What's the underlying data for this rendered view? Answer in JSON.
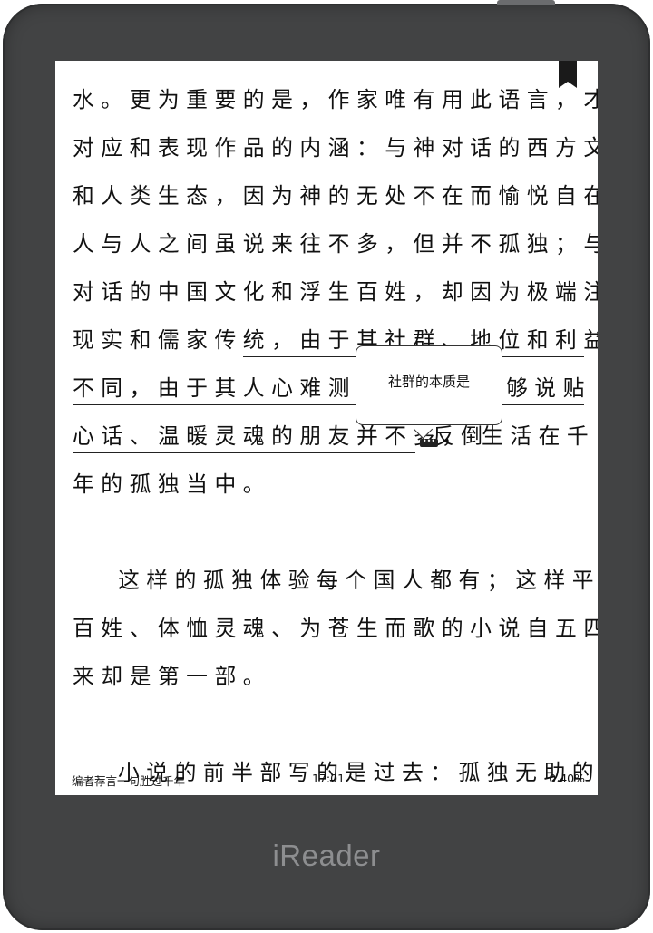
{
  "device": {
    "brand": "iReader"
  },
  "reader": {
    "lines": [
      "水。更为重要的是，作家唯有用此语言，才有",
      "对应和表现作品的内涵：与神对话的西方文化",
      "和人类生态，因为神的无处不在而愉悦自在。",
      "人与人之间虽说来往不多，但并不孤独；与人",
      "对话的中国文化和浮生百姓，却因为极端注重",
      "现实和儒家传统，由于其社群、地位和利益的",
      "不同，由于其人心难测和",
      "心话、温暖灵魂的朋友并不多，",
      "年的孤独当中。"
    ],
    "line7_tail": "够说贴",
    "line8_tail": "生活在千",
    "line8_hidden": "反倒",
    "paragraph2": [
      "这样的孤独体验每个国人都有；这样平视",
      "百姓、体恤灵魂、为苍生而歌的小说自五四以",
      "来却是第一部。"
    ],
    "paragraph3": [
      "小说的前半部写的是过去：孤独无助的吴"
    ],
    "note_popup": "社群的本质是",
    "note_marker": "•••"
  },
  "status_bar": {
    "chapter": "编者荐言一句胜过千年",
    "time": "17:01",
    "progress": "0.40%"
  },
  "colors": {
    "bezel": "#424344",
    "screen": "#ffffff",
    "text": "#111111",
    "brand": "#8d8e90"
  }
}
